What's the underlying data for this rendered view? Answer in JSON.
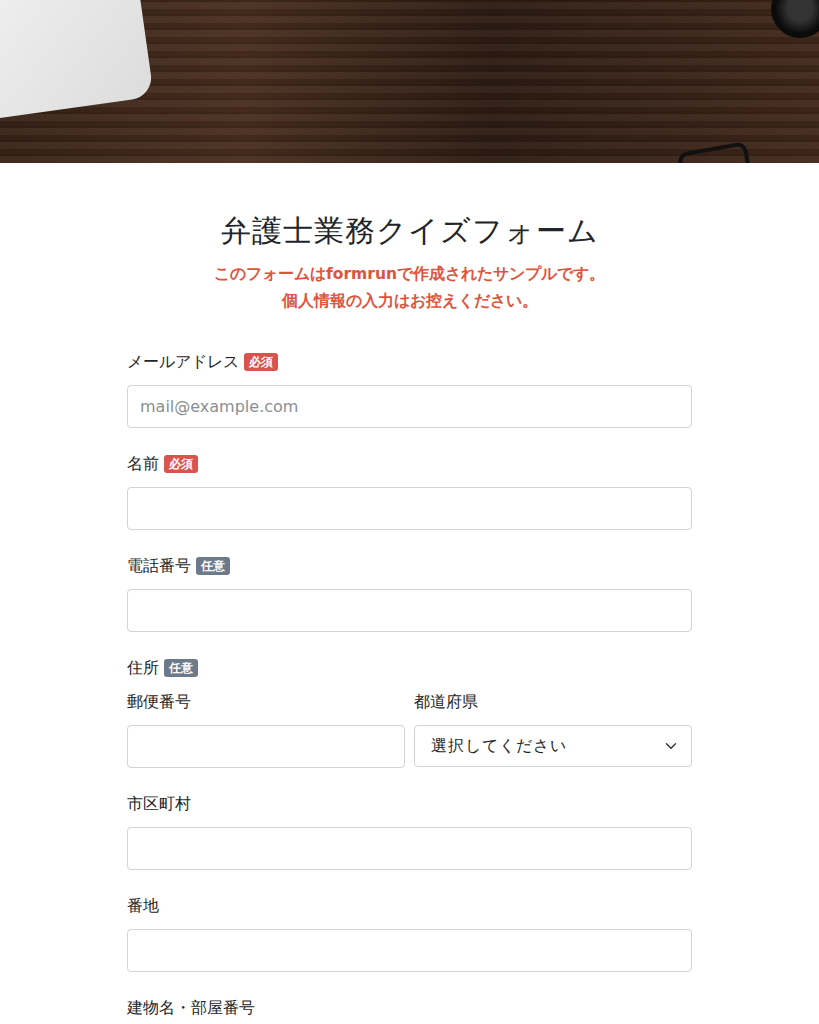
{
  "form": {
    "title": "弁護士業務クイズフォーム",
    "notice": [
      "このフォームはformrunで作成されたサンプルです。",
      "個人情報の入力はお控えください。"
    ]
  },
  "fields": [
    {
      "kind": "text",
      "label": "メールアドレス",
      "badge": "必須",
      "required": true,
      "placeholder": "mail@example.com"
    },
    {
      "kind": "text",
      "label": "名前",
      "badge": "必須",
      "required": true
    },
    {
      "kind": "text",
      "label": "電話番号",
      "badge": "任意",
      "required": false
    },
    {
      "kind": "address",
      "label": "住所",
      "badge": "任意",
      "required": false,
      "parts": [
        {
          "kind": "text",
          "label": "郵便番号"
        },
        {
          "kind": "select",
          "label": "都道府県",
          "value": "選択してください"
        },
        {
          "kind": "text",
          "label": "市区町村"
        },
        {
          "kind": "text",
          "label": "番地"
        },
        {
          "kind": "text",
          "label": "建物名・部屋番号"
        }
      ]
    }
  ]
}
